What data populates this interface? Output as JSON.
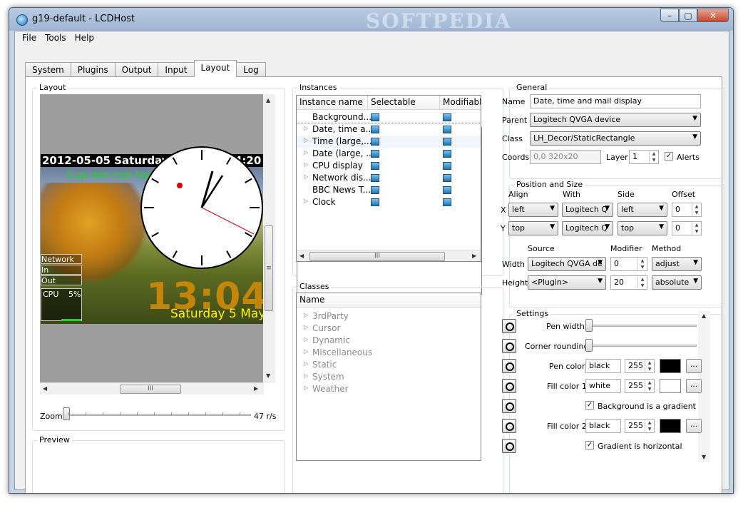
{
  "window": {
    "title": "g19-default - LCDHost",
    "watermark": "SOFTPEDIA",
    "buttons": {
      "minimize": "–",
      "maximize": "▢",
      "close": "✕"
    }
  },
  "menu": [
    "File",
    "Tools",
    "Help"
  ],
  "tabs": [
    "System",
    "Plugins",
    "Output",
    "Input",
    "Layout",
    "Log"
  ],
  "active_tab": "Layout",
  "layout_group": {
    "title": "Layout",
    "lcd": {
      "top_date": "2012-05-05 Saturday",
      "top_time_partial": "4:20",
      "ticker": "Cup win can top",
      "net_label": "Network",
      "in_label": "In",
      "out_label": "Out",
      "cpu_label": "CPU",
      "cpu_value": "5%",
      "big_time": "13:04",
      "date_line": "Saturday 5 May"
    },
    "zoom_label": "Zoom",
    "zoom_value": "47 r/s",
    "zoom_level_fraction": 0.0
  },
  "preview_group": {
    "title": "Preview"
  },
  "instances": {
    "title": "Instances",
    "columns": [
      "Instance name",
      "Selectable",
      "Modifiable"
    ],
    "rows": [
      {
        "name": "Background...",
        "expandable": false
      },
      {
        "name": "Date, time a...",
        "expandable": true
      },
      {
        "name": "Time (large,...",
        "expandable": true
      },
      {
        "name": "Date (large, ...",
        "expandable": true
      },
      {
        "name": "CPU display",
        "expandable": true
      },
      {
        "name": "Network dis...",
        "expandable": true
      },
      {
        "name": "BBC News T...",
        "expandable": false
      },
      {
        "name": "Clock",
        "expandable": true
      }
    ]
  },
  "classes": {
    "title": "Classes",
    "column": "Name",
    "items": [
      "3rdParty",
      "Cursor",
      "Dynamic",
      "Miscellaneous",
      "Static",
      "System",
      "Weather"
    ]
  },
  "general": {
    "title": "General",
    "name_label": "Name",
    "name_value": "Date, time and mail display",
    "parent_label": "Parent",
    "parent_value": "Logitech QVGA device",
    "class_label": "Class",
    "class_value": "LH_Decor/StaticRectangle",
    "coords_label": "Coords",
    "coords_value": "0,0 320x20",
    "layer_label": "Layer",
    "layer_value": "1",
    "alerts_label": "Alerts",
    "alerts_checked": true
  },
  "position": {
    "title": "Position and Size",
    "col_align": "Align",
    "col_with": "With",
    "col_side": "Side",
    "col_offset": "Offset",
    "x_label": "X",
    "x_align": "left",
    "x_with": "Logitech Q",
    "x_side": "left",
    "x_offset": "0",
    "y_label": "Y",
    "y_align": "top",
    "y_with": "Logitech Q",
    "y_side": "top",
    "y_offset": "0",
    "col_source": "Source",
    "col_modifier": "Modifier",
    "col_method": "Method",
    "width_label": "Width",
    "width_source": "Logitech QVGA de",
    "width_modifier": "0",
    "width_method": "adjust",
    "height_label": "Height",
    "height_source": "<Plugin>",
    "height_modifier": "20",
    "height_method": "absolute"
  },
  "settings": {
    "title": "Settings",
    "pen_width_label": "Pen width",
    "corner_label": "Corner rounding",
    "pen_color_label": "Pen color",
    "pen_color_value": "black",
    "pen_color_alpha": "255",
    "pen_color_hex": "#000000",
    "fill1_label": "Fill color 1",
    "fill1_value": "white",
    "fill1_alpha": "255",
    "fill1_hex": "#ffffff",
    "gradient_label": "Background is a gradient",
    "gradient_checked": true,
    "fill2_label": "Fill color 2",
    "fill2_value": "black",
    "fill2_alpha": "255",
    "fill2_hex": "#000000",
    "horizontal_label": "Gradient is horizontal",
    "horizontal_checked": true,
    "dots": "..."
  }
}
